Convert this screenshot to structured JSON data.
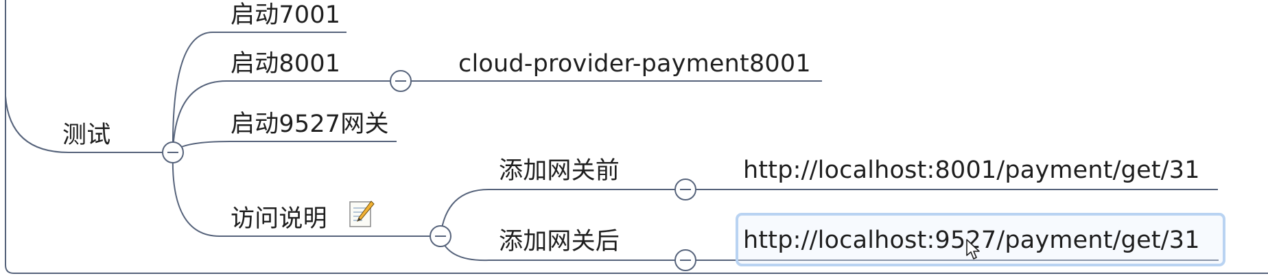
{
  "nodes": {
    "root": "测试",
    "start_7001": "启动7001",
    "start_8001": "启动8001",
    "provider_8001": "cloud-provider-payment8001",
    "start_9527": "启动9527网关",
    "access_desc": "访问说明",
    "before_gateway": "添加网关前",
    "url_before": "http://localhost:8001/payment/get/31",
    "after_gateway": "添加网关后",
    "url_after": "http://localhost:9527/payment/get/31"
  },
  "icons": {
    "collapse": "collapse-minus-icon",
    "note": "note-pencil-icon",
    "cursor": "mouse-pointer-icon"
  },
  "colors": {
    "line": "#55627a",
    "text": "#1e1e1e",
    "selection": "#b9d3f2"
  }
}
